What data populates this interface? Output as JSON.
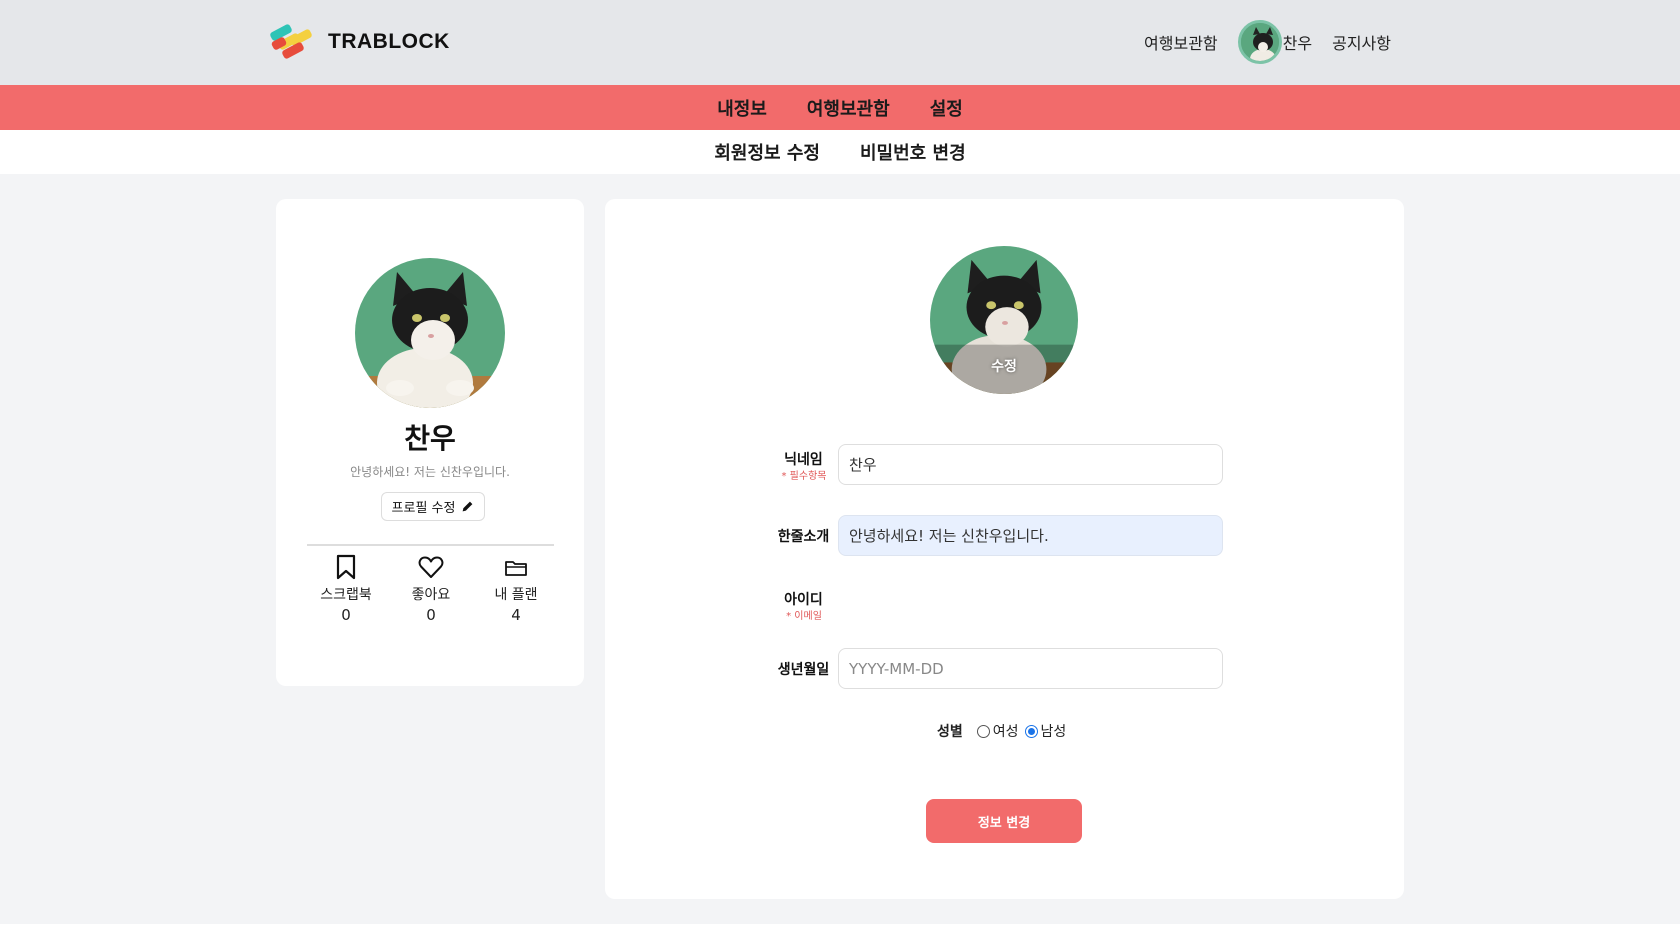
{
  "brand": {
    "name": "TRABLOCK",
    "colors": [
      "#2ec4b6",
      "#f4d03f",
      "#e74c3c",
      "#4aa3df"
    ]
  },
  "top_nav": {
    "storage": "여행보관함",
    "username": "찬우",
    "notice": "공지사항"
  },
  "tabs": [
    {
      "label": "내정보"
    },
    {
      "label": "여행보관함"
    },
    {
      "label": "설정"
    }
  ],
  "subtabs": [
    {
      "label": "회원정보 수정"
    },
    {
      "label": "비밀번호 변경"
    }
  ],
  "profile": {
    "name": "찬우",
    "intro": "안녕하세요! 저는 신찬우입니다.",
    "edit_label": "프로필 수정",
    "stats": [
      {
        "icon": "bookmark-icon",
        "label": "스크랩북",
        "count": "0"
      },
      {
        "icon": "heart-icon",
        "label": "좋아요",
        "count": "0"
      },
      {
        "icon": "folder-icon",
        "label": "내 플랜",
        "count": "4"
      }
    ]
  },
  "form": {
    "avatar_edit_label": "수정",
    "nickname": {
      "label": "닉네임",
      "required": "* 필수항목",
      "value": "찬우"
    },
    "intro": {
      "label": "한줄소개",
      "value": "안녕하세요! 저는 신찬우입니다."
    },
    "userid": {
      "label": "아이디",
      "required": "* 이메일"
    },
    "birth": {
      "label": "생년월일",
      "placeholder": "YYYY-MM-DD"
    },
    "gender": {
      "label": "성별",
      "female": "여성",
      "male": "남성",
      "selected": "남성"
    },
    "submit_label": "정보 변경"
  },
  "theme": {
    "accent": "#f26b6b",
    "header_bg": "#e5e7ea",
    "page_bg": "#f3f4f6"
  }
}
